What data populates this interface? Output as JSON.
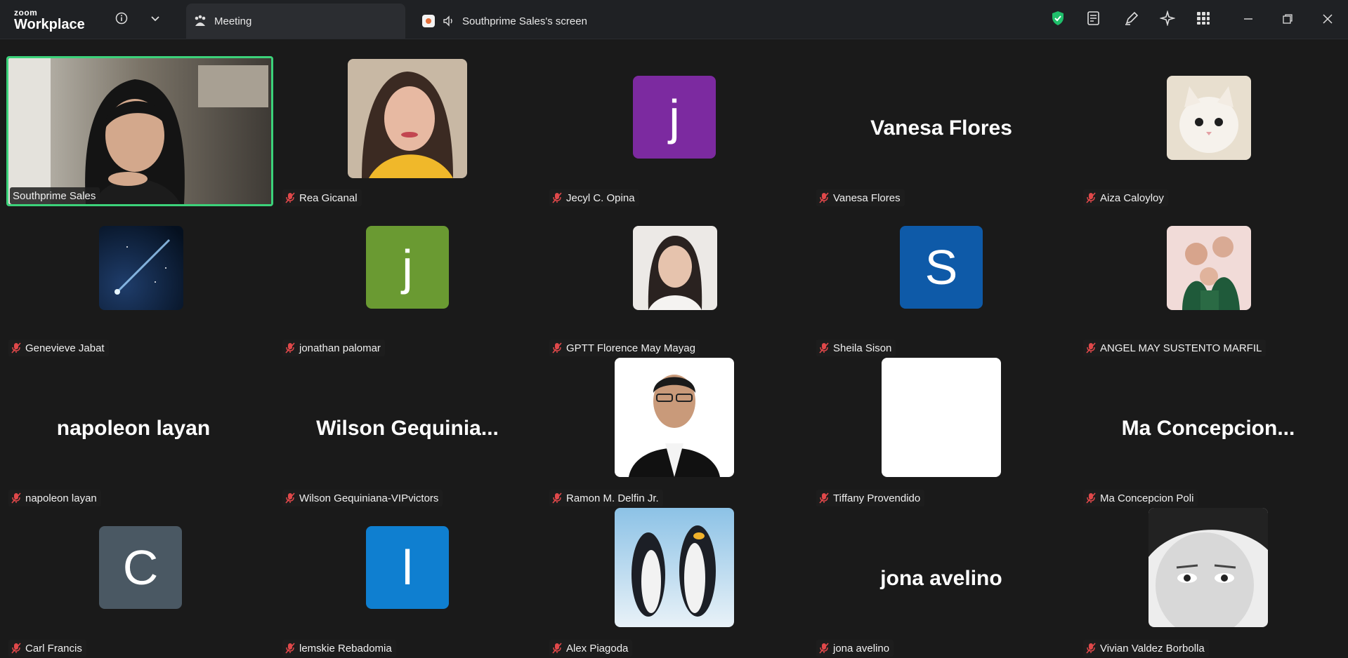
{
  "app": {
    "brand_top": "zoom",
    "brand_bottom": "Workplace"
  },
  "tabs": [
    {
      "label": "Meeting"
    },
    {
      "label": "Southprime Sales's screen"
    }
  ],
  "colors": {
    "speaking_border": "#3cd27a",
    "shield": "#1fbf6b",
    "mic_muted": "#e0484a"
  },
  "participants": [
    {
      "name": "Southprime Sales",
      "type": "video",
      "speaking": true,
      "muted": false
    },
    {
      "name": "Rea Gicanal",
      "type": "photo",
      "muted": true
    },
    {
      "name": "Jecyl C. Opina",
      "type": "letter",
      "letter": "j",
      "color": "#7c2aa0",
      "muted": true
    },
    {
      "name": "Vanesa Flores",
      "type": "text",
      "display": "Vanesa Flores",
      "muted": true
    },
    {
      "name": "Aiza Caloyloy",
      "type": "photo",
      "muted": true
    },
    {
      "name": "Genevieve Jabat",
      "type": "photo",
      "muted": true
    },
    {
      "name": "jonathan palomar",
      "type": "letter",
      "letter": "j",
      "color": "#6a9a32",
      "muted": true
    },
    {
      "name": "GPTT Florence May Mayag",
      "type": "photo",
      "muted": true
    },
    {
      "name": "Sheila Sison",
      "type": "letter",
      "letter": "S",
      "color": "#0e5aa8",
      "muted": true
    },
    {
      "name": "ANGEL MAY SUSTENTO MARFIL",
      "type": "photo",
      "muted": true
    },
    {
      "name": "napoleon layan",
      "type": "text",
      "display": "napoleon layan",
      "muted": true
    },
    {
      "name": "Wilson Gequiniana-VIPvictors",
      "type": "text",
      "display": "Wilson  Gequinia...",
      "muted": true
    },
    {
      "name": "Ramon M. Delfin Jr.",
      "type": "photo",
      "muted": true
    },
    {
      "name": "Tiffany Provendido",
      "type": "photo",
      "muted": true
    },
    {
      "name": "Ma Concepcion Poli",
      "type": "text",
      "display": "Ma  Concepcion...",
      "muted": true
    },
    {
      "name": "Carl Francis",
      "type": "letter",
      "letter": "C",
      "color": "#4a5863",
      "muted": true
    },
    {
      "name": "lemskie Rebadomia",
      "type": "letter",
      "letter": "l",
      "color": "#0f7fd0",
      "muted": true
    },
    {
      "name": "Alex Piagoda",
      "type": "photo",
      "muted": true
    },
    {
      "name": "jona avelino",
      "type": "text",
      "display": "jona avelino",
      "muted": true
    },
    {
      "name": "Vivian Valdez Borbolla",
      "type": "photo",
      "muted": true
    }
  ]
}
